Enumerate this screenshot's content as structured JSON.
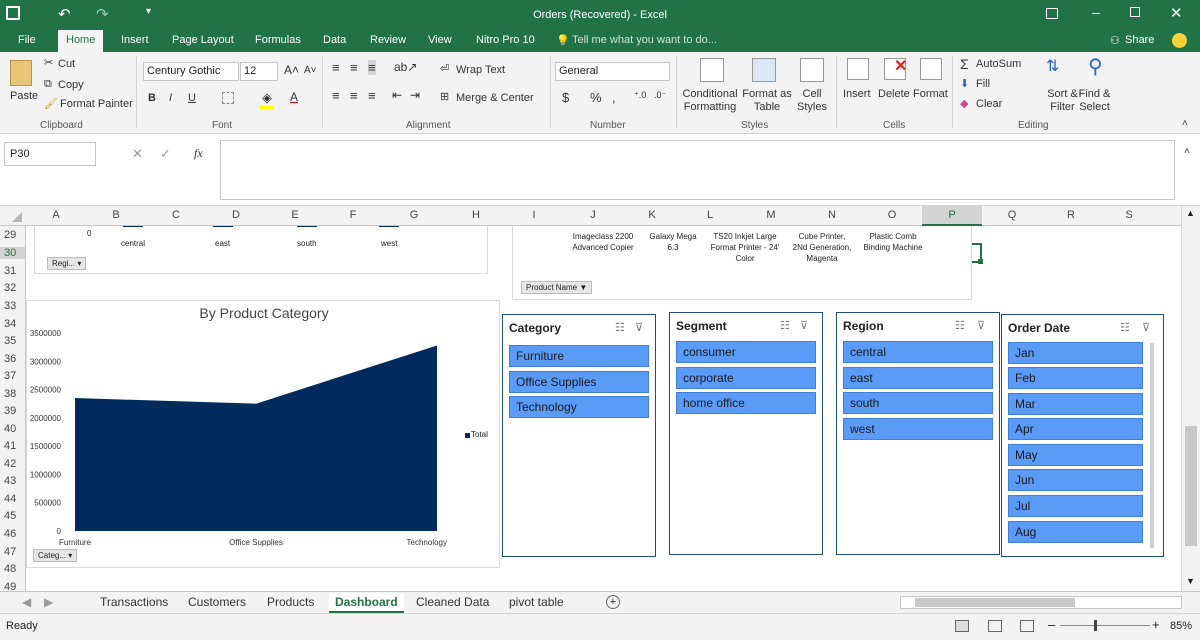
{
  "window": {
    "title": "Orders (Recovered) - Excel"
  },
  "menu": {
    "items": [
      "File",
      "Home",
      "Insert",
      "Page Layout",
      "Formulas",
      "Data",
      "Review",
      "View",
      "Nitro Pro 10"
    ],
    "tell_me": "Tell me what you want to do...",
    "share": "Share"
  },
  "ribbon": {
    "clipboard": {
      "paste": "Paste",
      "cut": "Cut",
      "copy": "Copy",
      "format_painter": "Format Painter",
      "label": "Clipboard"
    },
    "font": {
      "family": "Century Gothic",
      "size": "12",
      "label": "Font",
      "bold": "B",
      "italic": "I",
      "underline": "U"
    },
    "alignment": {
      "wrap": "Wrap Text",
      "merge": "Merge & Center",
      "label": "Alignment"
    },
    "number": {
      "format": "General",
      "currency": "$",
      "percent": "%",
      "comma": ",",
      "label": "Number"
    },
    "styles": {
      "conditional": "Conditional Formatting",
      "format_table": "Format as Table",
      "cell_styles": "Cell Styles",
      "label": "Styles"
    },
    "cells": {
      "insert": "Insert",
      "delete": "Delete",
      "format": "Format",
      "label": "Cells"
    },
    "editing": {
      "autosum": "AutoSum",
      "fill": "Fill",
      "clear": "Clear",
      "sort": "Sort & Filter",
      "find": "Find & Select",
      "label": "Editing"
    }
  },
  "formula_bar": {
    "name_box": "P30",
    "fx": "fx",
    "value": ""
  },
  "columns": [
    "A",
    "B",
    "C",
    "D",
    "E",
    "F",
    "G",
    "H",
    "I",
    "J",
    "K",
    "L",
    "M",
    "N",
    "O",
    "P",
    "Q",
    "R",
    "S"
  ],
  "rows": [
    "29",
    "30",
    "31",
    "32",
    "33",
    "34",
    "35",
    "36",
    "37",
    "38",
    "39",
    "40",
    "41",
    "42",
    "43",
    "44",
    "45",
    "46",
    "47",
    "48",
    "49"
  ],
  "top_chart": {
    "zero": "0",
    "categories": [
      "central",
      "east",
      "south",
      "west"
    ],
    "field_button": "Regi..."
  },
  "product_chart": {
    "labels": [
      "Imageclass 2200 Advanced Copier",
      "Galaxy Mega 6.3",
      "TS20 Inkjet Large Format Printer - 24' Color",
      "Cube Printer, 2Nd Generation, Magenta",
      "Plastic Comb Binding Machine"
    ],
    "field_button": "Product Name"
  },
  "chart_data": {
    "type": "area",
    "title": "By Product Category",
    "categories": [
      "Furniture",
      "Office Supplies",
      "Technology"
    ],
    "series": [
      {
        "name": "Total",
        "values": [
          2350000,
          2250000,
          3280000
        ]
      }
    ],
    "ylim": [
      0,
      3500000
    ],
    "yticks": [
      "3500000",
      "3000000",
      "2500000",
      "2000000",
      "1500000",
      "1000000",
      "500000",
      "0"
    ],
    "legend": "right",
    "color": "#002b5c",
    "field_button": "Categ..."
  },
  "slicers": {
    "category": {
      "title": "Category",
      "items": [
        "Furniture",
        "Office Supplies",
        "Technology"
      ]
    },
    "segment": {
      "title": "Segment",
      "items": [
        "consumer",
        "corporate",
        "home office"
      ]
    },
    "region": {
      "title": "Region",
      "items": [
        "central",
        "east",
        "south",
        "west"
      ]
    },
    "order_date": {
      "title": "Order Date",
      "items": [
        "Jan",
        "Feb",
        "Mar",
        "Apr",
        "May",
        "Jun",
        "Jul",
        "Aug"
      ]
    }
  },
  "sheets": [
    "Transactions",
    "Customers",
    "Products",
    "Dashboard",
    "Cleaned Data",
    "pivot table"
  ],
  "status": {
    "ready": "Ready",
    "zoom": "85%"
  },
  "colors": {
    "excel_green": "#217346",
    "slicer_fill": "#5b9bf8",
    "chart_fill": "#002b5c"
  }
}
